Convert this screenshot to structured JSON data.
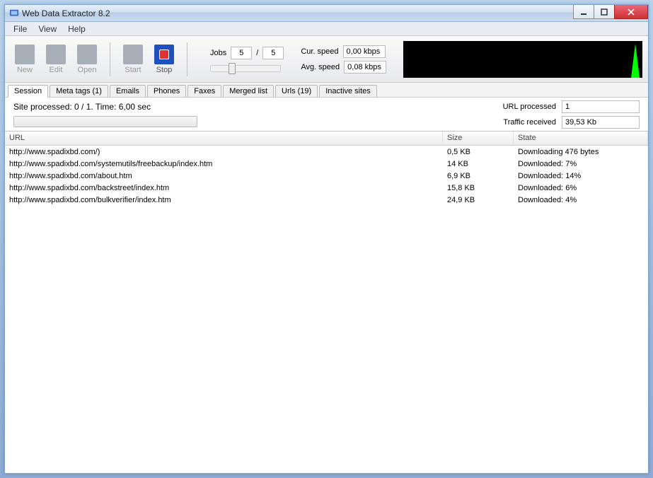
{
  "window": {
    "title": "Web Data Extractor 8.2"
  },
  "menu": {
    "file": "File",
    "view": "View",
    "help": "Help"
  },
  "toolbar": {
    "new": "New",
    "edit": "Edit",
    "open": "Open",
    "start": "Start",
    "stop": "Stop",
    "jobs_label": "Jobs",
    "jobs_cur": "5",
    "jobs_sep": "/",
    "jobs_max": "5",
    "cur_speed_label": "Cur. speed",
    "cur_speed_value": "0,00 kbps",
    "avg_speed_label": "Avg. speed",
    "avg_speed_value": "0,08 kbps"
  },
  "tabs": [
    {
      "label": "Session",
      "active": true
    },
    {
      "label": "Meta tags (1)",
      "active": false
    },
    {
      "label": "Emails",
      "active": false
    },
    {
      "label": "Phones",
      "active": false
    },
    {
      "label": "Faxes",
      "active": false
    },
    {
      "label": "Merged list",
      "active": false
    },
    {
      "label": "Urls (19)",
      "active": false
    },
    {
      "label": "Inactive sites",
      "active": false
    }
  ],
  "session": {
    "status": "Site processed: 0 / 1. Time: 6,00 sec",
    "url_processed_label": "URL processed",
    "url_processed_value": "1",
    "traffic_label": "Traffic received",
    "traffic_value": "39,53 Kb"
  },
  "table": {
    "headers": {
      "url": "URL",
      "size": "Size",
      "state": "State"
    },
    "rows": [
      {
        "url": "http://www.spadixbd.com/)",
        "size": "0,5 KB",
        "state": "Downloading 476 bytes"
      },
      {
        "url": "http://www.spadixbd.com/systemutils/freebackup/index.htm",
        "size": "14 KB",
        "state": "Downloaded: 7%"
      },
      {
        "url": "http://www.spadixbd.com/about.htm",
        "size": "6,9 KB",
        "state": "Downloaded: 14%"
      },
      {
        "url": "http://www.spadixbd.com/backstreet/index.htm",
        "size": "15,8 KB",
        "state": "Downloaded: 6%"
      },
      {
        "url": "http://www.spadixbd.com/bulkverifier/index.htm",
        "size": "24,9 KB",
        "state": "Downloaded: 4%"
      }
    ]
  }
}
